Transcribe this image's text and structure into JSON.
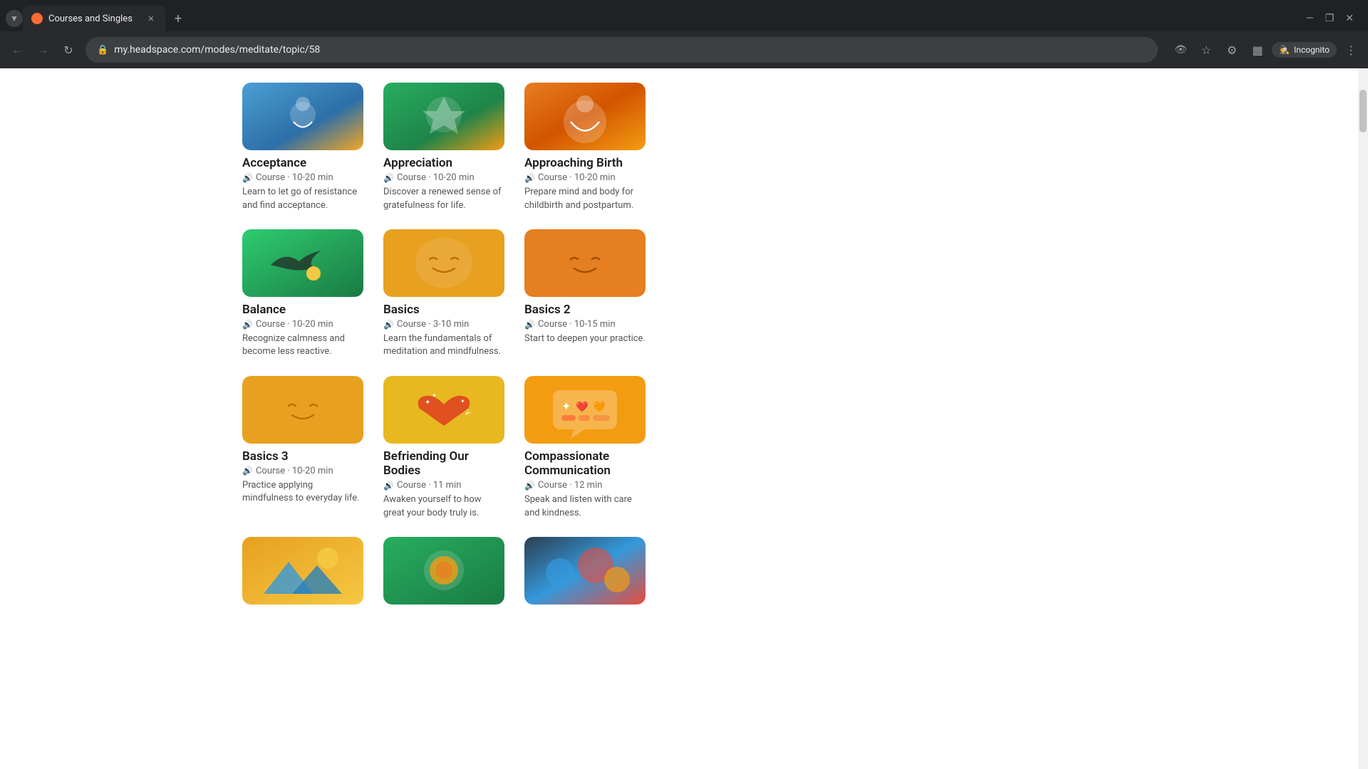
{
  "browser": {
    "tab_title": "Courses and Singles",
    "tab_favicon_color": "#ff6b35",
    "url": "my.headspace.com/modes/meditate/topic/58",
    "incognito_label": "Incognito",
    "new_tab_label": "+",
    "window_controls": {
      "minimize": "—",
      "maximize": "❐",
      "close": "✕"
    }
  },
  "courses": [
    {
      "id": "acceptance",
      "title": "Acceptance",
      "type": "Course",
      "duration": "10-20 min",
      "description": "Learn to let go of resistance and find acceptance.",
      "thumb_type": "acceptance"
    },
    {
      "id": "appreciation",
      "title": "Appreciation",
      "type": "Course",
      "duration": "10-20 min",
      "description": "Discover a renewed sense of gratefulness for life.",
      "thumb_type": "appreciation"
    },
    {
      "id": "approaching-birth",
      "title": "Approaching Birth",
      "type": "Course",
      "duration": "10-20 min",
      "description": "Prepare mind and body for childbirth and postpartum.",
      "thumb_type": "approaching-birth"
    },
    {
      "id": "balance",
      "title": "Balance",
      "type": "Course",
      "duration": "10-20 min",
      "description": "Recognize calmness and become less reactive.",
      "thumb_type": "balance"
    },
    {
      "id": "basics",
      "title": "Basics",
      "type": "Course",
      "duration": "3-10 min",
      "description": "Learn the fundamentals of meditation and mindfulness.",
      "thumb_type": "basics"
    },
    {
      "id": "basics-2",
      "title": "Basics 2",
      "type": "Course",
      "duration": "10-15 min",
      "description": "Start to deepen your practice.",
      "thumb_type": "basics2"
    },
    {
      "id": "basics-3",
      "title": "Basics 3",
      "type": "Course",
      "duration": "10-20 min",
      "description": "Practice applying mindfulness to everyday life.",
      "thumb_type": "basics3"
    },
    {
      "id": "befriending-our-bodies",
      "title": "Befriending Our Bodies",
      "type": "Course",
      "duration": "11 min",
      "description": "Awaken yourself to how great your body truly is.",
      "thumb_type": "befriending"
    },
    {
      "id": "compassionate-communication",
      "title": "Compassionate Communication",
      "type": "Course",
      "duration": "12 min",
      "description": "Speak and listen with care and kindness.",
      "thumb_type": "compassionate"
    },
    {
      "id": "bottom1",
      "title": "",
      "type": "",
      "duration": "",
      "description": "",
      "thumb_type": "bottom1"
    },
    {
      "id": "bottom2",
      "title": "",
      "type": "",
      "duration": "",
      "description": "",
      "thumb_type": "bottom2"
    },
    {
      "id": "bottom3",
      "title": "",
      "type": "",
      "duration": "",
      "description": "",
      "thumb_type": "bottom3"
    }
  ]
}
